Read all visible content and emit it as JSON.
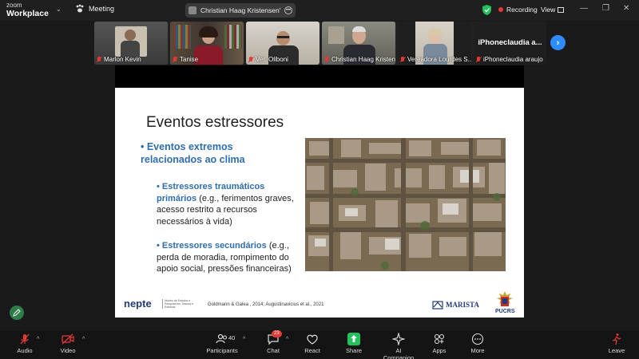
{
  "app": {
    "brand_top": "zoom",
    "brand_bottom": "Workplace"
  },
  "topbar": {
    "meeting_label": "Meeting",
    "share_label": "Christian Haag Kristensen's scree",
    "recording_label": "Recording",
    "view_label": "View"
  },
  "participants_strip": [
    {
      "name": "Marlon Kevin"
    },
    {
      "name": "Tanise"
    },
    {
      "name": "Ver. Oliboni"
    },
    {
      "name": "Christian Haag Kristensen"
    },
    {
      "name": "Vereadora Lourdes S..."
    },
    {
      "name": "iPhoneclaudia araujo",
      "center_name": "iPhoneclaudia a..."
    }
  ],
  "slide": {
    "title": "Eventos estressores",
    "bullet1": "• Eventos extremos relacionados ao clima",
    "sub1_bold": "• Estressores traumáticos primários",
    "sub1_rest": " (e.g., ferimentos graves, acesso restrito a recursos necessários à vida)",
    "sub2_bold": "• Estressores secundários",
    "sub2_rest": " (e.g., perda de moradia, rompimento do apoio social, pressões financeiras)",
    "logo_left": "nepte",
    "logo_left_small": "Núcleo de Estudos e Pesquisa em Trauma e Estresse",
    "citation": "Goldmann & Galea , 2014; Augustinavicius et al., 2021",
    "logo_marista": "MARISTA",
    "logo_pucrs": "PUCRS"
  },
  "toolbar": {
    "audio": "Audio",
    "video": "Video",
    "participants": "Participants",
    "participants_count": "40",
    "chat": "Chat",
    "chat_badge": "23",
    "react": "React",
    "share": "Share",
    "ai": "AI Companion",
    "apps": "Apps",
    "more": "More",
    "leave": "Leave"
  },
  "colors": {
    "accent_blue": "#2d8cff",
    "active_green": "#21c15b",
    "muted_red": "#e53935",
    "slide_blue": "#2f6db0"
  }
}
